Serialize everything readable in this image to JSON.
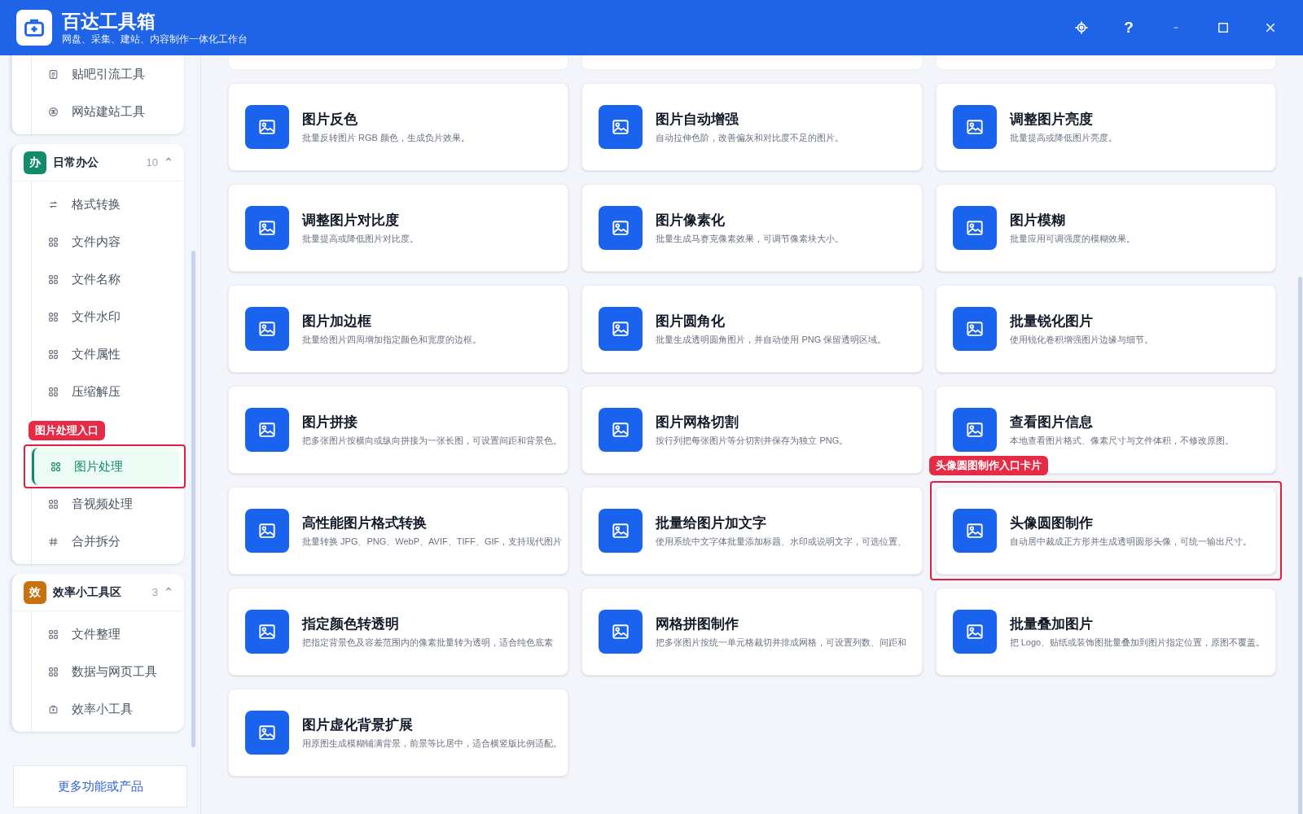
{
  "header": {
    "title": "百达工具箱",
    "subtitle": "网盘、采集、建站、内容制作一体化工作台",
    "help_button": "?"
  },
  "sidebar": {
    "groups": [
      {
        "items": [
          {
            "label": "贴吧引流工具",
            "selected": false
          },
          {
            "label": "网站建站工具",
            "selected": false
          }
        ]
      },
      {
        "header": {
          "badge": "办",
          "color": "#138a6b",
          "title": "日常办公",
          "count": "10",
          "expanded": true
        },
        "items": [
          {
            "label": "格式转换",
            "selected": false
          },
          {
            "label": "文件内容",
            "selected": false
          },
          {
            "label": "文件名称",
            "selected": false
          },
          {
            "label": "文件水印",
            "selected": false
          },
          {
            "label": "文件属性",
            "selected": false
          },
          {
            "label": "压缩解压",
            "selected": false
          },
          {
            "label": "图片处理",
            "selected": true,
            "callout": "图片处理入口"
          },
          {
            "label": "音视频处理",
            "selected": false
          },
          {
            "label": "合并拆分",
            "selected": false
          }
        ]
      },
      {
        "header": {
          "badge": "效",
          "color": "#c9700f",
          "title": "效率小工具区",
          "count": "3",
          "expanded": true
        },
        "items": [
          {
            "label": "文件整理",
            "selected": false
          },
          {
            "label": "数据与网页工具",
            "selected": false
          },
          {
            "label": "效率小工具",
            "selected": false
          }
        ]
      }
    ],
    "more_button": "更多功能或产品"
  },
  "cards": [
    {
      "title": "图片反色",
      "description": "批量反转图片 RGB 颜色，生成负片效果。"
    },
    {
      "title": "图片自动增强",
      "description": "自动拉伸色阶，改善偏灰和对比度不足的图片。"
    },
    {
      "title": "调整图片亮度",
      "description": "批量提高或降低图片亮度。"
    },
    {
      "title": "调整图片对比度",
      "description": "批量提高或降低图片对比度。"
    },
    {
      "title": "图片像素化",
      "description": "批量生成马赛克像素效果，可调节像素块大小。"
    },
    {
      "title": "图片模糊",
      "description": "批量应用可调强度的模糊效果。"
    },
    {
      "title": "图片加边框",
      "description": "批量给图片四周增加指定颜色和宽度的边框。"
    },
    {
      "title": "图片圆角化",
      "description": "批量生成透明圆角图片，并自动使用 PNG 保留透明区域。"
    },
    {
      "title": "批量锐化图片",
      "description": "使用锐化卷积增强图片边缘与细节。"
    },
    {
      "title": "图片拼接",
      "description": "把多张图片按横向或纵向拼接为一张长图，可设置间距和背景色。"
    },
    {
      "title": "图片网格切割",
      "description": "按行列把每张图片等分切割并保存为独立 PNG。"
    },
    {
      "title": "查看图片信息",
      "description": "本地查看图片格式、像素尺寸与文件体积，不修改原图。"
    },
    {
      "title": "高性能图片格式转换",
      "description": "批量转换 JPG、PNG、WebP、AVIF、TIFF、GIF，支持现代图片"
    },
    {
      "title": "批量给图片加文字",
      "description": "使用系统中文字体批量添加标题、水印或说明文字，可选位置、"
    },
    {
      "title": "头像圆图制作",
      "description": "自动居中裁成正方形并生成透明圆形头像，可统一输出尺寸。",
      "callout": "头像圆图制作入口卡片"
    },
    {
      "title": "指定颜色转透明",
      "description": "把指定背景色及容差范围内的像素批量转为透明，适合纯色底素"
    },
    {
      "title": "网格拼图制作",
      "description": "把多张图片按统一单元格裁切并排成网格，可设置列数、间距和"
    },
    {
      "title": "批量叠加图片",
      "description": "把 Logo、贴纸或装饰图批量叠加到图片指定位置，原图不覆盖。"
    },
    {
      "title": "图片虚化背景扩展",
      "description": "用原图生成模糊铺满背景，前景等比居中，适合横竖版比例适配。"
    }
  ]
}
